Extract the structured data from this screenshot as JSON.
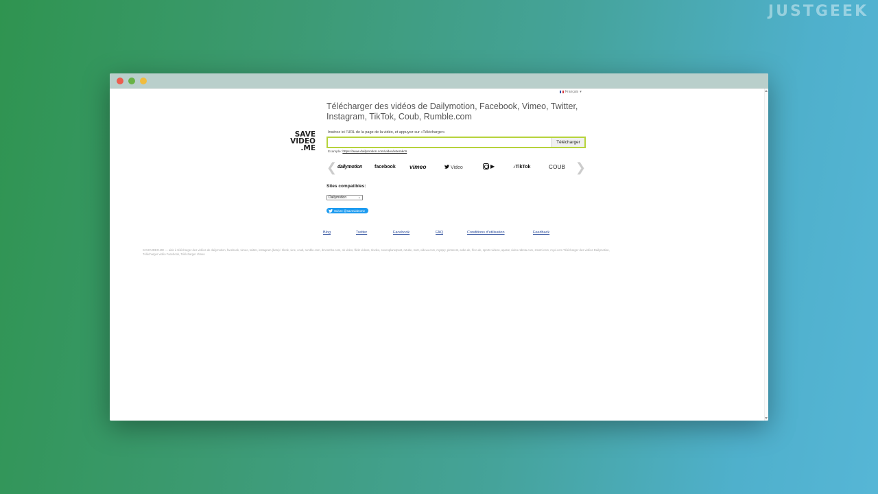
{
  "watermark": "JUSTGEEK",
  "language": "Français",
  "headline": "Télécharger des vidéos de Dailymotion, Facebook, Vimeo, Twitter, Instagram, TikTok, Coub, Rumble.com",
  "logo": [
    "SAVE",
    "VIDEO",
    ".ME"
  ],
  "form": {
    "instruction": "Insérez ici l'URL de la page de la vidéo, et appuyez sur «Télécharger»",
    "input_value": "",
    "button_label": "Télécharger",
    "example_label": "Example:",
    "example_url": "https://www.dailymotion.com/video/x6emkc6"
  },
  "carousel": {
    "prev": "❮",
    "next": "❯",
    "services": [
      "dailymotion",
      "facebook",
      "vimeo",
      "Video",
      "▶",
      "TikTok",
      "COUB"
    ]
  },
  "sites": {
    "label": "Sites compatibles:",
    "selected": "Dailymotion"
  },
  "twitter_follow": "Suivre @savevideome",
  "footer_links": [
    "Blog",
    "Twitter",
    "Facebook",
    "FAQ",
    "Conditions d'utilisation",
    "Feedback"
  ],
  "description": "SAVEVIDEO.ME — aide à télécharger des vidéos de dailymotion, facebook, vimeo, twitter, instagram (beta) / tiktok, vine, coub, rumble.com, dmcombo.com, ok video, flickr videos, rkvdeo, sevenplanetpost, rutube, mx8, videvu.com, myspry, pinterest, anbe.de, frivo.de, sports videos, aparat, video.rabota.com, smotri.com, myvi.com Télécharger des vidéos Dailymotion, Télécharger vidéo Facebook, Télécharger Vimeo",
  "colors": {
    "input_border": "#b6d33b",
    "twitter_blue": "#1d9bf0",
    "link": "#2a4b9b"
  }
}
